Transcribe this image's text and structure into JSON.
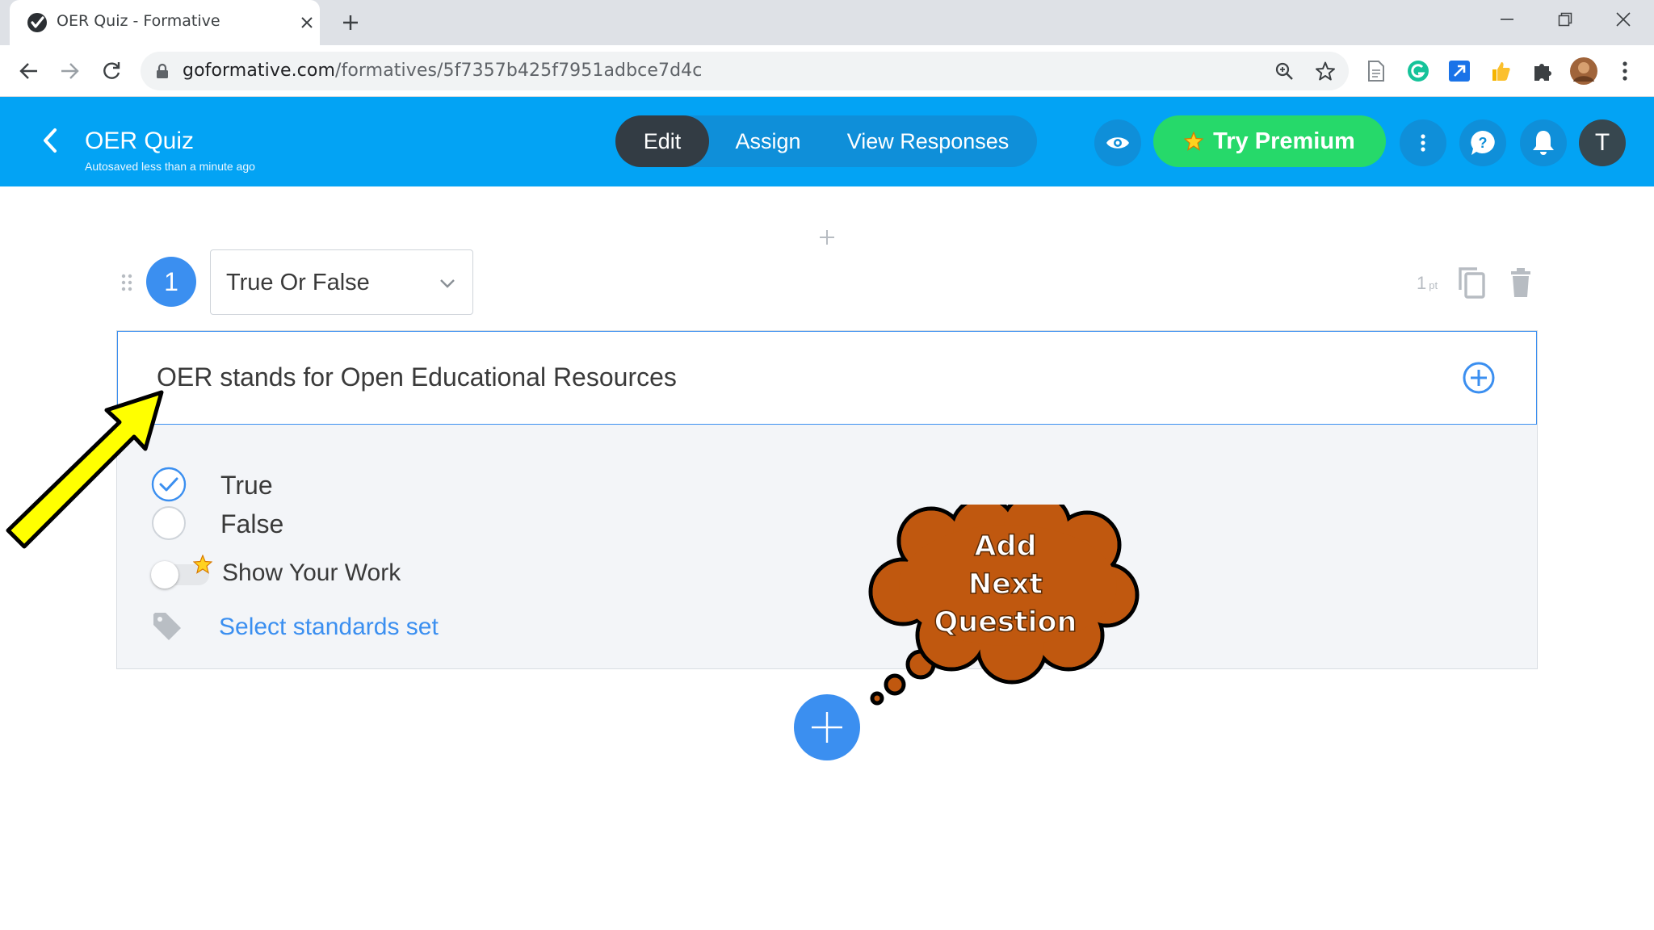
{
  "browser": {
    "tab": {
      "title": "OER Quiz - Formative",
      "favicon": "formative-check-icon"
    },
    "url": {
      "host": "goformative.com",
      "path": "/formatives/5f7357b425f7951adbce7d4c"
    },
    "icons": [
      "back-arrow-icon",
      "forward-arrow-icon",
      "reload-icon",
      "lock-icon",
      "zoom-icon",
      "star-icon",
      "puzzle-icon",
      "kebab-menu-icon"
    ]
  },
  "header": {
    "title": "OER Quiz",
    "autosave": "Autosaved less than a minute ago",
    "modes": {
      "edit": "Edit",
      "assign": "Assign",
      "view_responses": "View Responses"
    },
    "premium_label": "Try Premium",
    "avatar_letter": "T",
    "colors": {
      "bar": "#03a3f4",
      "active_mode": "#333c44",
      "premium": "#26d96a"
    }
  },
  "question": {
    "number": "1",
    "type": "True Or False",
    "points_value": "1",
    "points_unit": "pt",
    "prompt": "OER stands for Open Educational Resources",
    "choices": [
      {
        "label": "True",
        "selected": true
      },
      {
        "label": "False",
        "selected": false
      }
    ],
    "show_your_work": {
      "label": "Show Your Work",
      "enabled": false
    },
    "standards_link": "Select standards set"
  },
  "annotation": {
    "callout_lines": [
      "Add",
      "Next",
      "Question"
    ],
    "colors": {
      "cloud": "#c0580f",
      "arrow": "#ffff00"
    }
  }
}
